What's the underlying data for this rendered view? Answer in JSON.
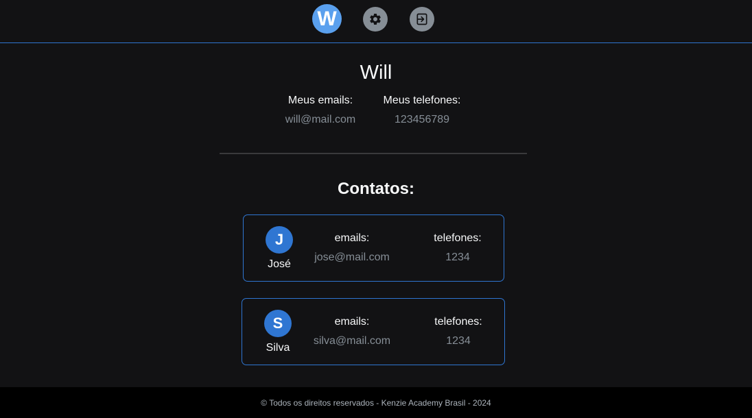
{
  "header": {
    "avatar_letter": "W",
    "settings_icon": "gear-icon",
    "logout_icon": "logout-icon"
  },
  "profile": {
    "name": "Will",
    "emails_label": "Meus emails:",
    "phones_label": "Meus telefones:",
    "email": "will@mail.com",
    "phone": "123456789"
  },
  "contacts": {
    "title": "Contatos:",
    "items": [
      {
        "letter": "J",
        "name": "José",
        "emails_label": "emails:",
        "phones_label": "telefones:",
        "email": "jose@mail.com",
        "phone": "1234"
      },
      {
        "letter": "S",
        "name": "Silva",
        "emails_label": "emails:",
        "phones_label": "telefones:",
        "email": "silva@mail.com",
        "phone": "1234"
      }
    ]
  },
  "footer": {
    "text": "© Todos os direitos reservados - Kenzie Academy Brasil - 2024"
  },
  "colors": {
    "accent": "#2f76d2",
    "background": "#121214",
    "muted": "#868e96"
  }
}
